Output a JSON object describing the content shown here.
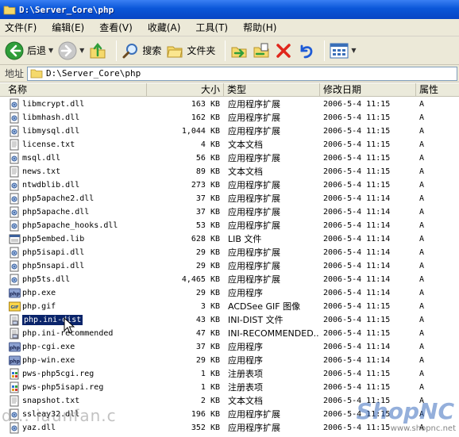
{
  "window": {
    "title": "D:\\Server_Core\\php"
  },
  "menu": [
    {
      "label": "文件(F)"
    },
    {
      "label": "编辑(E)"
    },
    {
      "label": "查看(V)"
    },
    {
      "label": "收藏(A)"
    },
    {
      "label": "工具(T)"
    },
    {
      "label": "帮助(H)"
    }
  ],
  "toolbar": {
    "back_label": "后退",
    "search_label": "搜索",
    "folders_label": "文件夹"
  },
  "address": {
    "label": "地址",
    "value": "D:\\Server_Core\\php"
  },
  "columns": {
    "name": "名称",
    "size": "大小",
    "type": "类型",
    "modified": "修改日期",
    "attr": "属性"
  },
  "files": [
    {
      "name": "libmcrypt.dll",
      "size": "163 KB",
      "type": "应用程序扩展",
      "date": "2006-5-4 11:15",
      "attr": "A",
      "icon": "dll-icon"
    },
    {
      "name": "libmhash.dll",
      "size": "162 KB",
      "type": "应用程序扩展",
      "date": "2006-5-4 11:15",
      "attr": "A",
      "icon": "dll-icon"
    },
    {
      "name": "libmysql.dll",
      "size": "1,044 KB",
      "type": "应用程序扩展",
      "date": "2006-5-4 11:15",
      "attr": "A",
      "icon": "dll-icon"
    },
    {
      "name": "license.txt",
      "size": "4 KB",
      "type": "文本文档",
      "date": "2006-5-4 11:15",
      "attr": "A",
      "icon": "txt-icon"
    },
    {
      "name": "msql.dll",
      "size": "56 KB",
      "type": "应用程序扩展",
      "date": "2006-5-4 11:15",
      "attr": "A",
      "icon": "dll-icon"
    },
    {
      "name": "news.txt",
      "size": "89 KB",
      "type": "文本文档",
      "date": "2006-5-4 11:15",
      "attr": "A",
      "icon": "txt-icon"
    },
    {
      "name": "ntwdblib.dll",
      "size": "273 KB",
      "type": "应用程序扩展",
      "date": "2006-5-4 11:15",
      "attr": "A",
      "icon": "dll-icon"
    },
    {
      "name": "php5apache2.dll",
      "size": "37 KB",
      "type": "应用程序扩展",
      "date": "2006-5-4 11:14",
      "attr": "A",
      "icon": "dll-icon"
    },
    {
      "name": "php5apache.dll",
      "size": "37 KB",
      "type": "应用程序扩展",
      "date": "2006-5-4 11:14",
      "attr": "A",
      "icon": "dll-icon"
    },
    {
      "name": "php5apache_hooks.dll",
      "size": "53 KB",
      "type": "应用程序扩展",
      "date": "2006-5-4 11:14",
      "attr": "A",
      "icon": "dll-icon"
    },
    {
      "name": "php5embed.lib",
      "size": "628 KB",
      "type": "LIB 文件",
      "date": "2006-5-4 11:14",
      "attr": "A",
      "icon": "lib-icon"
    },
    {
      "name": "php5isapi.dll",
      "size": "29 KB",
      "type": "应用程序扩展",
      "date": "2006-5-4 11:14",
      "attr": "A",
      "icon": "dll-icon"
    },
    {
      "name": "php5nsapi.dll",
      "size": "29 KB",
      "type": "应用程序扩展",
      "date": "2006-5-4 11:14",
      "attr": "A",
      "icon": "dll-icon"
    },
    {
      "name": "php5ts.dll",
      "size": "4,465 KB",
      "type": "应用程序扩展",
      "date": "2006-5-4 11:14",
      "attr": "A",
      "icon": "dll-icon"
    },
    {
      "name": "php.exe",
      "size": "29 KB",
      "type": "应用程序",
      "date": "2006-5-4 11:14",
      "attr": "A",
      "icon": "php-exe-icon"
    },
    {
      "name": "php.gif",
      "size": "3 KB",
      "type": "ACDSee GIF 图像",
      "date": "2006-5-4 11:15",
      "attr": "A",
      "icon": "gif-icon"
    },
    {
      "name": "php.ini-dist",
      "size": "43 KB",
      "type": "INI-DIST 文件",
      "date": "2006-5-4 11:15",
      "attr": "A",
      "icon": "ini-icon",
      "selected": true
    },
    {
      "name": "php.ini-recommended",
      "size": "47 KB",
      "type": "INI-RECOMMENDED...",
      "date": "2006-5-4 11:15",
      "attr": "A",
      "icon": "ini-icon"
    },
    {
      "name": "php-cgi.exe",
      "size": "37 KB",
      "type": "应用程序",
      "date": "2006-5-4 11:14",
      "attr": "A",
      "icon": "php-exe-icon"
    },
    {
      "name": "php-win.exe",
      "size": "29 KB",
      "type": "应用程序",
      "date": "2006-5-4 11:14",
      "attr": "A",
      "icon": "php-exe-icon"
    },
    {
      "name": "pws-php5cgi.reg",
      "size": "1 KB",
      "type": "注册表项",
      "date": "2006-5-4 11:15",
      "attr": "A",
      "icon": "reg-icon"
    },
    {
      "name": "pws-php5isapi.reg",
      "size": "1 KB",
      "type": "注册表项",
      "date": "2006-5-4 11:15",
      "attr": "A",
      "icon": "reg-icon"
    },
    {
      "name": "snapshot.txt",
      "size": "2 KB",
      "type": "文本文档",
      "date": "2006-5-4 11:15",
      "attr": "A",
      "icon": "txt-icon"
    },
    {
      "name": "ssleay32.dll",
      "size": "196 KB",
      "type": "应用程序扩展",
      "date": "2006-5-4 11:15",
      "attr": "A",
      "icon": "dll-icon"
    },
    {
      "name": "yaz.dll",
      "size": "352 KB",
      "type": "应用程序扩展",
      "date": "2006-5-4 11:15",
      "attr": "A",
      "icon": "dll-icon"
    }
  ],
  "watermark": {
    "left_text": "d... iaunfan.c",
    "logo": "ShopNC",
    "url": "www.shopnc.net"
  },
  "colors": {
    "titlebar": "#0a56d8",
    "selection": "#0a246a",
    "chrome": "#ece9d8"
  }
}
